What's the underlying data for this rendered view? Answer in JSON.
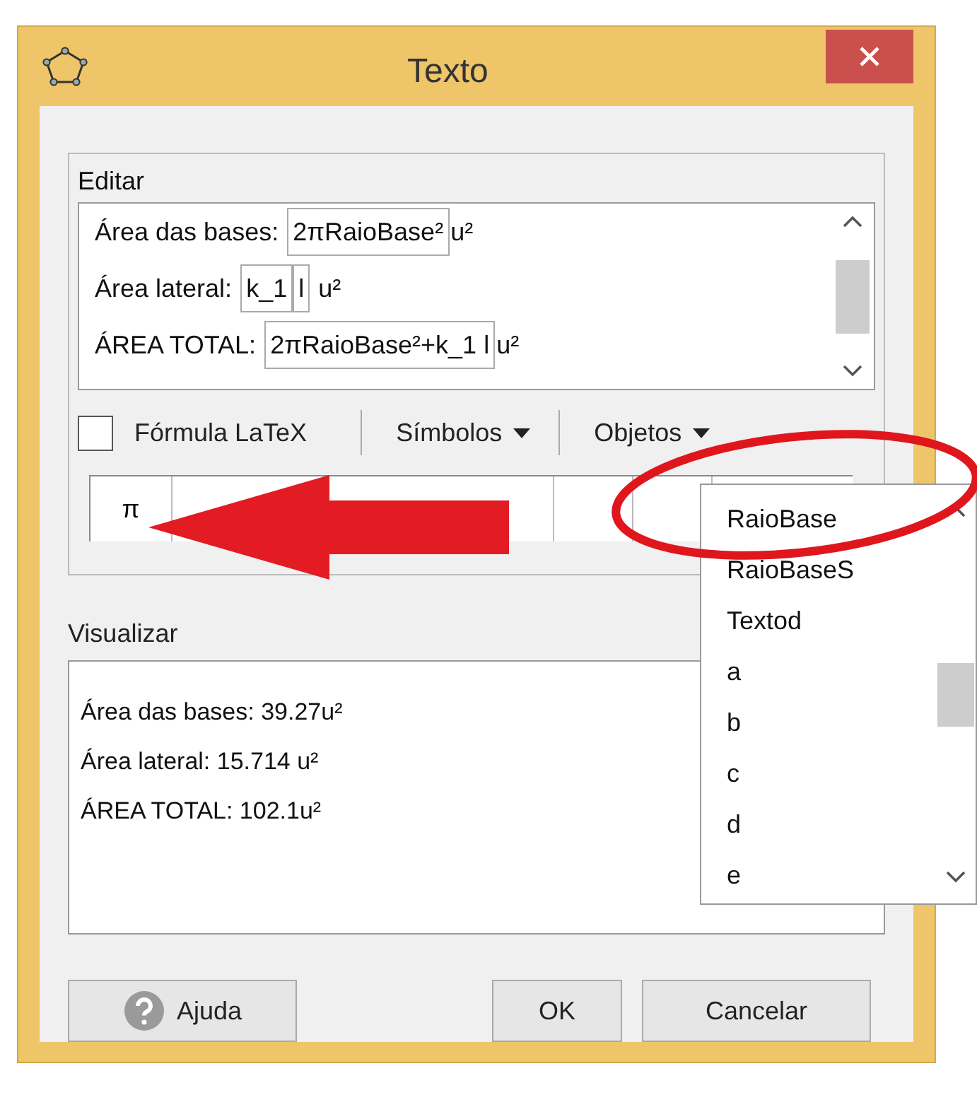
{
  "window": {
    "title": "Texto"
  },
  "edit_panel": {
    "label": "Editar",
    "lines": [
      {
        "parts": [
          {
            "kind": "text",
            "text": "Área das bases: "
          },
          {
            "kind": "object",
            "text": "2πRaioBase²"
          },
          {
            "kind": "text",
            "text": "u²"
          }
        ]
      },
      {
        "parts": [
          {
            "kind": "text",
            "text": "Área lateral: "
          },
          {
            "kind": "object",
            "text": "k_1"
          },
          {
            "kind": "object",
            "text": "l"
          },
          {
            "kind": "text",
            "text": " u²"
          }
        ]
      },
      {
        "parts": [
          {
            "kind": "text",
            "text": "ÁREA TOTAL: "
          },
          {
            "kind": "object",
            "text": "2πRaioBase²+k_1 l"
          },
          {
            "kind": "text",
            "text": "u²"
          }
        ]
      }
    ]
  },
  "latex": {
    "label": "Fórmula LaTeX",
    "checked": false
  },
  "menus": [
    {
      "label": "Símbolos"
    },
    {
      "label": "Objetos"
    }
  ],
  "symbols": [
    "π"
  ],
  "objects_list": [
    "RaioBase",
    "RaioBaseS",
    "Textod",
    "a",
    "b",
    "c",
    "d",
    "e"
  ],
  "preview_panel": {
    "label": "Visualizar",
    "lines": [
      "Área das bases: 39.27u²",
      "Área lateral: 15.714 u²",
      "ÁREA TOTAL: 102.1u²"
    ]
  },
  "buttons": [
    {
      "kind": "help",
      "label": "Ajuda"
    },
    {
      "kind": "plain",
      "label": "OK"
    },
    {
      "kind": "plain",
      "label": "Cancelar"
    }
  ]
}
